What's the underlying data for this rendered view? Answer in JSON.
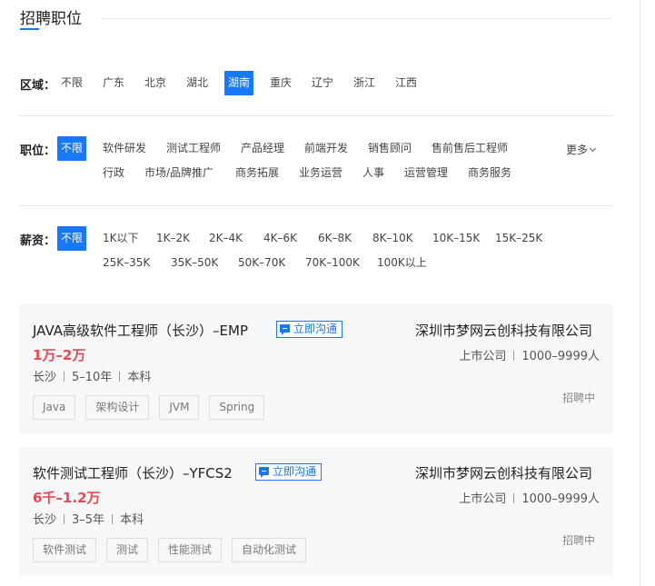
{
  "section": {
    "title": "招聘职位"
  },
  "filters": {
    "region": {
      "label": "区域：",
      "options": [
        "不限",
        "广东",
        "北京",
        "湖北",
        "湖南",
        "重庆",
        "辽宁",
        "浙江",
        "江西"
      ],
      "selected": "湖南"
    },
    "position": {
      "label": "职位：",
      "options_row1": [
        "不限",
        "软件研发",
        "测试工程师",
        "产品经理",
        "前端开发",
        "销售顾问",
        "售前售后工程师"
      ],
      "options_row2": [
        "行政",
        "市场/品牌推广",
        "商务拓展",
        "业务运营",
        "人事",
        "运营管理",
        "商务服务"
      ],
      "more_label": "更多",
      "selected": "不限"
    },
    "salary": {
      "label": "薪资：",
      "options_row1": [
        "不限",
        "1K以下",
        "1K–2K",
        "2K–4K",
        "4K–6K",
        "6K–8K",
        "8K–10K",
        "10K–15K",
        "15K–25K"
      ],
      "options_row2": [
        "25K–35K",
        "35K–50K",
        "50K–70K",
        "70K–100K",
        "100K以上"
      ],
      "selected": "不限"
    }
  },
  "jobs": [
    {
      "title": "JAVA高级软件工程师（长沙）–EMP",
      "chat_label": "立即沟通",
      "salary": "1万–2万",
      "city": "长沙",
      "experience": "5–10年",
      "education": "本科",
      "tags": [
        "Java",
        "架构设计",
        "JVM",
        "Spring"
      ],
      "company": "深圳市梦网云创科技有限公司",
      "company_type": "上市公司",
      "company_size": "1000–9999人",
      "status": "招聘中"
    },
    {
      "title": "软件测试工程师（长沙）–YFCS2",
      "chat_label": "立即沟通",
      "salary": "6千–1.2万",
      "city": "长沙",
      "experience": "3–5年",
      "education": "本科",
      "tags": [
        "软件测试",
        "测试",
        "性能测试",
        "自动化测试"
      ],
      "company": "深圳市梦网云创科技有限公司",
      "company_type": "上市公司",
      "company_size": "1000–9999人",
      "status": "招聘中"
    }
  ],
  "colors": {
    "accent": "#1677ff",
    "salary": "#f5454a",
    "card_bg": "#f6f7f9"
  }
}
